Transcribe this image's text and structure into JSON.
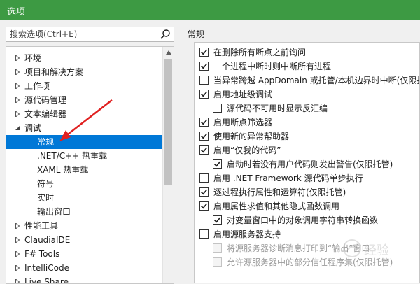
{
  "window": {
    "title": "选项"
  },
  "search": {
    "placeholder": "搜索选项(Ctrl+E)",
    "icon": "search-icon"
  },
  "tree": {
    "items": [
      {
        "label": "环境",
        "expander": "collapsed"
      },
      {
        "label": "项目和解决方案",
        "expander": "collapsed"
      },
      {
        "label": "工作项",
        "expander": "collapsed"
      },
      {
        "label": "源代码管理",
        "expander": "collapsed"
      },
      {
        "label": "文本编辑器",
        "expander": "collapsed"
      },
      {
        "label": "调试",
        "expander": "expanded"
      },
      {
        "label": "常规",
        "expander": "none",
        "selected": true
      },
      {
        "label": ".NET/C++ 热重载",
        "expander": "none"
      },
      {
        "label": "XAML 热重载",
        "expander": "none"
      },
      {
        "label": "符号",
        "expander": "none"
      },
      {
        "label": "实时",
        "expander": "none"
      },
      {
        "label": "输出窗口",
        "expander": "none"
      },
      {
        "label": "性能工具",
        "expander": "collapsed"
      },
      {
        "label": "ClaudiaIDE",
        "expander": "collapsed"
      },
      {
        "label": "F# Tools",
        "expander": "collapsed"
      },
      {
        "label": "IntelliCode",
        "expander": "collapsed"
      },
      {
        "label": "Live Share",
        "expander": "collapsed"
      }
    ]
  },
  "main": {
    "section_title": "常规",
    "options": [
      {
        "label": "在删除所有断点之前询问",
        "checked": true,
        "indent": 0,
        "disabled": false
      },
      {
        "label": "一个进程中断时则中断所有进程",
        "checked": true,
        "indent": 0,
        "disabled": false
      },
      {
        "label": "当异常跨越 AppDomain 或托管/本机边界时中断(仅限托",
        "checked": false,
        "indent": 0,
        "disabled": false
      },
      {
        "label": "启用地址级调试",
        "checked": true,
        "indent": 0,
        "disabled": false
      },
      {
        "label": "源代码不可用时显示反汇编",
        "checked": false,
        "indent": 1,
        "disabled": false
      },
      {
        "label": "启用断点筛选器",
        "checked": true,
        "indent": 0,
        "disabled": false
      },
      {
        "label": "使用新的异常帮助器",
        "checked": true,
        "indent": 0,
        "disabled": false
      },
      {
        "label": "启用“仅我的代码”",
        "checked": true,
        "indent": 0,
        "disabled": false
      },
      {
        "label": "启动时若没有用户代码则发出警告(仅限托管)",
        "checked": true,
        "indent": 1,
        "disabled": false
      },
      {
        "label": "启用 .NET Framework 源代码单步执行",
        "checked": false,
        "indent": 0,
        "disabled": false
      },
      {
        "label": "逐过程执行属性和运算符(仅限托管)",
        "checked": true,
        "indent": 0,
        "disabled": false
      },
      {
        "label": "启用属性求值和其他隐式函数调用",
        "checked": true,
        "indent": 0,
        "disabled": false
      },
      {
        "label": "对变量窗口中的对象调用字符串转换函数",
        "checked": true,
        "indent": 1,
        "disabled": false
      },
      {
        "label": "启用源服务器支持",
        "checked": false,
        "indent": 0,
        "disabled": false
      },
      {
        "label": "将源服务器诊断消息打印到“输出”窗口",
        "checked": false,
        "indent": 1,
        "disabled": true
      },
      {
        "label": "允许源服务器中的部分信任程序集(仅限托管)",
        "checked": false,
        "indent": 1,
        "disabled": true
      }
    ]
  },
  "colors": {
    "titlebar": "#3d9a43",
    "selection": "#0078d7",
    "annotation_arrow": "#e02020"
  },
  "watermark": {
    "text": "经验",
    "logo": "baidu-jingyan-logo"
  }
}
